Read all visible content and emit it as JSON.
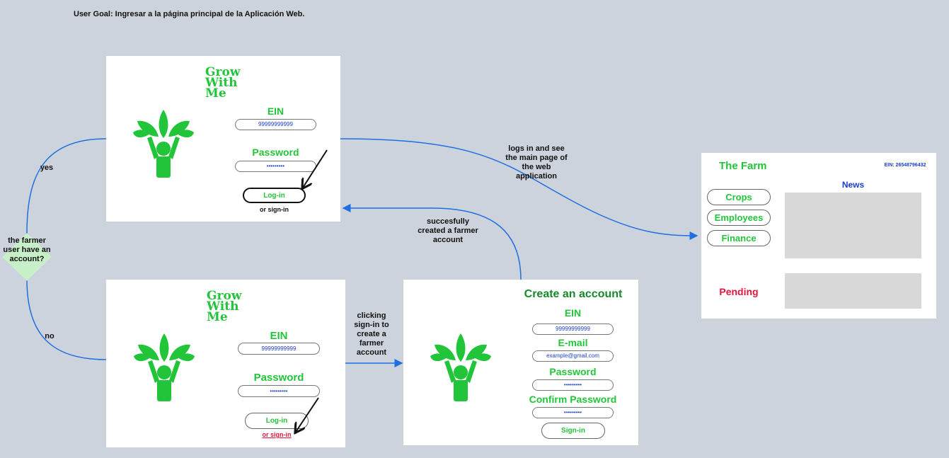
{
  "user_goal": "User Goal: Ingresar a la página principal de la Aplicación Web.",
  "colors": {
    "green": "#22c53a",
    "blue_text": "#1a3ecc",
    "connector": "#1f6fe0",
    "pending": "#e0163a"
  },
  "login_top": {
    "logo": [
      "Grow",
      "With",
      "Me"
    ],
    "ein_label": "EIN",
    "ein_value": "99999999999",
    "password_label": "Password",
    "password_value": "•••••••••",
    "login_button": "Log-in",
    "signin_text": "or sign-in"
  },
  "login_bottom": {
    "logo": [
      "Grow",
      "With",
      "Me"
    ],
    "ein_label": "EIN",
    "ein_value": "99999999999",
    "password_label": "Password",
    "password_value": "•••••••••",
    "login_button": "Log-in",
    "signin_text": "or sign-in"
  },
  "create_account": {
    "title": "Create an account",
    "ein_label": "EIN",
    "ein_value": "99999999999",
    "email_label": "E-mail",
    "email_value": "example@gmail.com",
    "password_label": "Password",
    "password_value": "•••••••••",
    "confirm_label": "Confirm Password",
    "confirm_value": "•••••••••",
    "signin_button": "Sign-in"
  },
  "farm": {
    "title": "The Farm",
    "ein": "EIN: 26548796432",
    "nav": [
      "Crops",
      "Employees",
      "Finance"
    ],
    "news_label": "News",
    "pending_label": "Pending"
  },
  "flow": {
    "decision": "the farmer user have an account?",
    "yes": "yes",
    "no": "no",
    "logs_in": "logs in and see the main page of the web application",
    "clicking": "clicking sign-in to create a farmer account",
    "success": "succesfully created a farmer account"
  }
}
